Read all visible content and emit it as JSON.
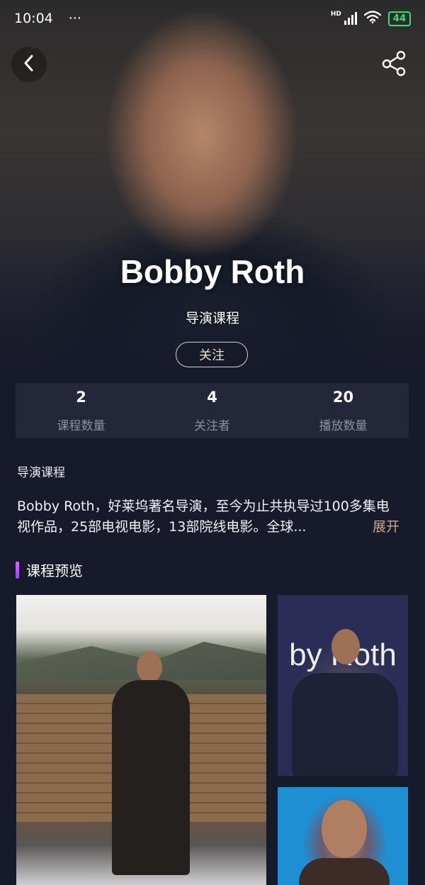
{
  "status_bar": {
    "time": "10:04",
    "dots": "···",
    "hd": "HD",
    "battery": "44"
  },
  "hero": {
    "name": "Bobby Roth",
    "subtitle": "导演课程",
    "follow_label": "关注"
  },
  "stats": [
    {
      "value": "2",
      "label": "课程数量"
    },
    {
      "value": "4",
      "label": "关注者"
    },
    {
      "value": "20",
      "label": "播放数量"
    }
  ],
  "intro": {
    "section_label": "导演课程",
    "text": "Bobby Roth，好莱坞著名导演，至今为止共执导过100多集电视作品，25部电视电影，13部院线电影。全球...",
    "more_label": "展开"
  },
  "preview": {
    "title": "课程预览",
    "thumb_2_overlay_text": "by Roth"
  },
  "colors": {
    "background": "#171a2b",
    "stat_card": "#232739",
    "accent_purple": "#b156f5",
    "expand_link": "#c9a88a",
    "battery_green": "#3ddc72"
  },
  "icons": [
    "back-arrow-icon",
    "share-icon",
    "wifi-icon",
    "signal-icon",
    "battery-icon"
  ]
}
